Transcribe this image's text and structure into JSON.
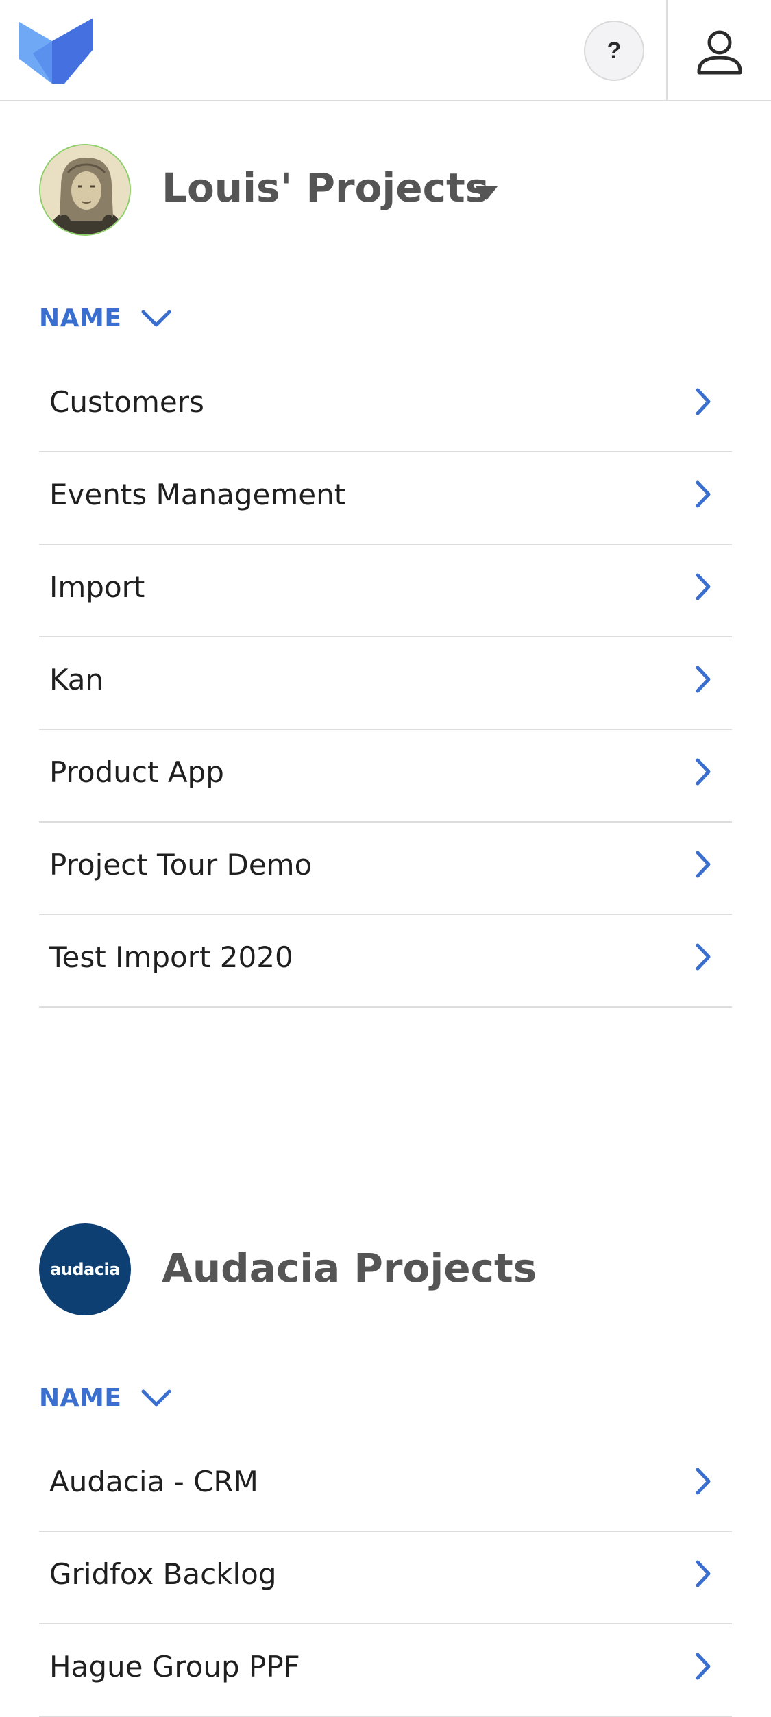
{
  "header": {
    "help_label": "?",
    "brand_color": "#4a7ee8",
    "icons": [
      "logo-icon",
      "help-icon",
      "user-icon"
    ]
  },
  "sections": [
    {
      "title": "Louis' Projects",
      "has_dropdown": true,
      "avatar": "portrait-avatar",
      "sort_label": "NAME",
      "items": [
        {
          "label": "Customers"
        },
        {
          "label": "Events Management"
        },
        {
          "label": "Import"
        },
        {
          "label": "Kan"
        },
        {
          "label": "Product App"
        },
        {
          "label": "Project Tour Demo"
        },
        {
          "label": "Test Import 2020"
        }
      ]
    },
    {
      "title": "Audacia Projects",
      "has_dropdown": false,
      "avatar_text": "audacia",
      "avatar_color": "#0d3f73",
      "sort_label": "NAME",
      "items": [
        {
          "label": "Audacia - CRM"
        },
        {
          "label": "Gridfox Backlog"
        },
        {
          "label": "Hague Group PPF"
        }
      ]
    }
  ],
  "colors": {
    "accent": "#3a6fd0",
    "title": "#555555",
    "divider": "#dddddd"
  }
}
